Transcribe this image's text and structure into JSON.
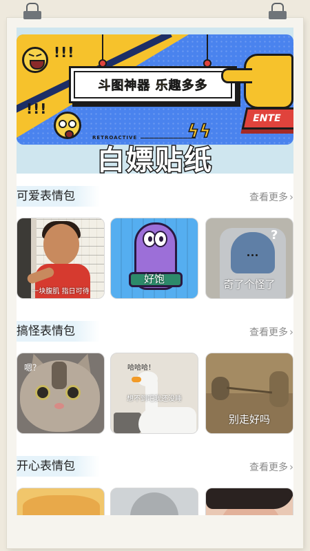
{
  "banner": {
    "tagline": "斗图神器 乐趣多多",
    "retro_text": "RETROACTIVE",
    "enter_key": "ENTE",
    "exclaim_1": "!!!",
    "exclaim_2": "!!!",
    "title": "白嫖贴纸"
  },
  "sections": [
    {
      "title": "可爱表情包",
      "more": "查看更多",
      "items": [
        {
          "caption": "一块腹肌 指日可待"
        },
        {
          "caption": "好饱"
        },
        {
          "caption": "奇了个怪了"
        }
      ]
    },
    {
      "title": "搞怪表情包",
      "more": "查看更多",
      "items": [
        {
          "caption": "嗯？"
        },
        {
          "caption_top": "哈哈哈！",
          "caption": "想不到吧我还没睡"
        },
        {
          "caption": "别走好吗"
        }
      ]
    },
    {
      "title": "开心表情包",
      "more": "查看更多",
      "items": [
        {
          "caption": ""
        },
        {
          "caption": ""
        },
        {
          "caption": ""
        }
      ]
    }
  ],
  "colors": {
    "banner_blue": "#4a83ee",
    "banner_yellow": "#f6c22c",
    "section_highlight": "#e6f3fa",
    "more_text": "#8a8a8a"
  }
}
